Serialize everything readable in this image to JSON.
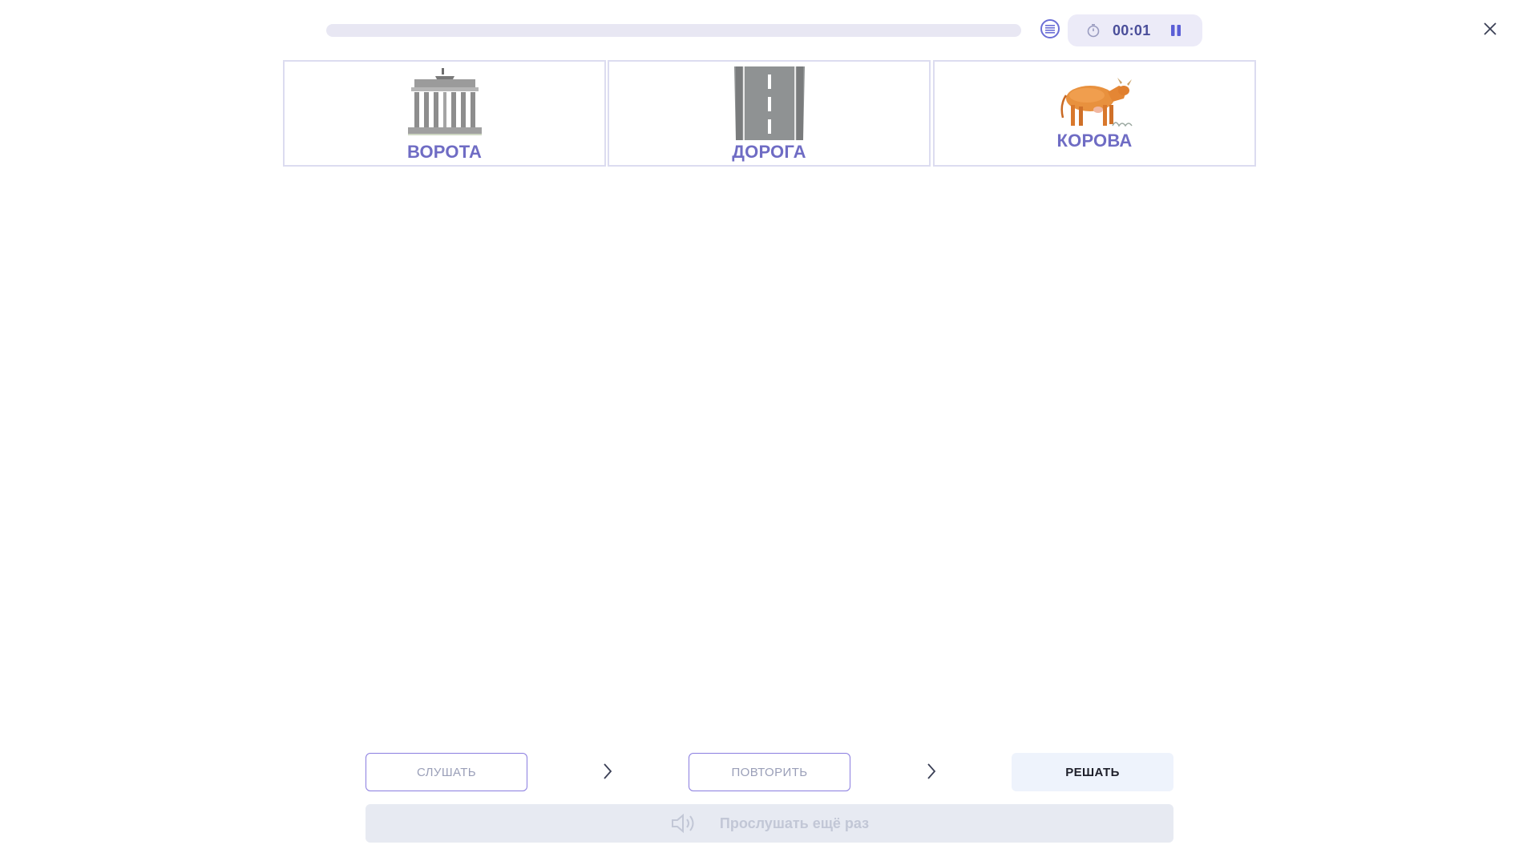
{
  "header": {
    "progress_fraction": 0.0,
    "timer": "00:01",
    "icons": {
      "list": "list-circle-icon",
      "timer": "stopwatch-icon",
      "pause": "pause-icon",
      "close": "close-icon"
    }
  },
  "cards": [
    {
      "word": "ВОРОТА",
      "image": "gate-illustration"
    },
    {
      "word": "ДОРОГА",
      "image": "road-illustration"
    },
    {
      "word": "КОРОВА",
      "image": "cow-illustration"
    }
  ],
  "steps": {
    "listen": "СЛУШАТЬ",
    "repeat": "ПОВТОРИТЬ",
    "solve": "РЕШАТЬ"
  },
  "listen_again": {
    "label": "Прослушать ещё раз",
    "icon": "speaker-icon"
  },
  "colors": {
    "accent": "#6f6cc4",
    "progress_track": "#e8e7f3",
    "timer_bg": "#ecebf8",
    "button_disabled_bg": "#e7eaf2",
    "active_step_bg": "#eef3fc"
  }
}
